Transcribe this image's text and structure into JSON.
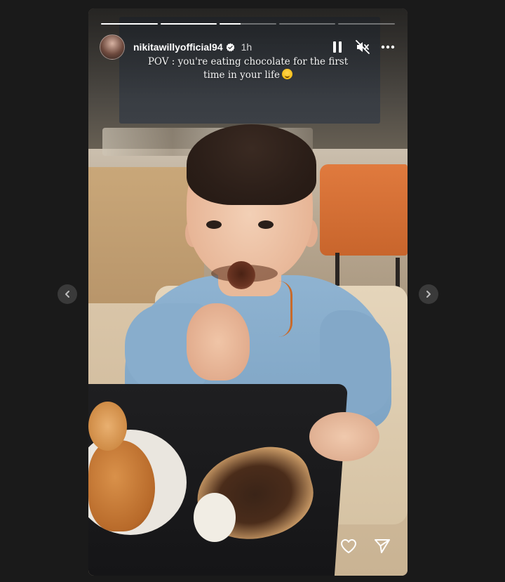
{
  "story": {
    "progress_segments": [
      1.0,
      1.0,
      0.37,
      0.0,
      0.0
    ],
    "username": "nikitawillyofficial94",
    "verified": true,
    "time_ago": "1h",
    "caption_line1": "POV : you're eating chocolate for the first",
    "caption_line2": "time in your life",
    "caption_emoji": "rolling-on-floor-laughing-emoji"
  },
  "controls": {
    "pause_icon": "pause-icon",
    "mute_icon": "muted-speaker-icon",
    "more_icon": "more-options-icon"
  },
  "footer": {
    "like_icon": "heart-icon",
    "share_icon": "send-icon"
  },
  "navigation": {
    "prev_icon": "chevron-left-icon",
    "next_icon": "chevron-right-icon"
  },
  "colors": {
    "page_background": "#1a1a1a",
    "nav_button": "#3a3a3a",
    "verified_badge": "#ffffff"
  }
}
